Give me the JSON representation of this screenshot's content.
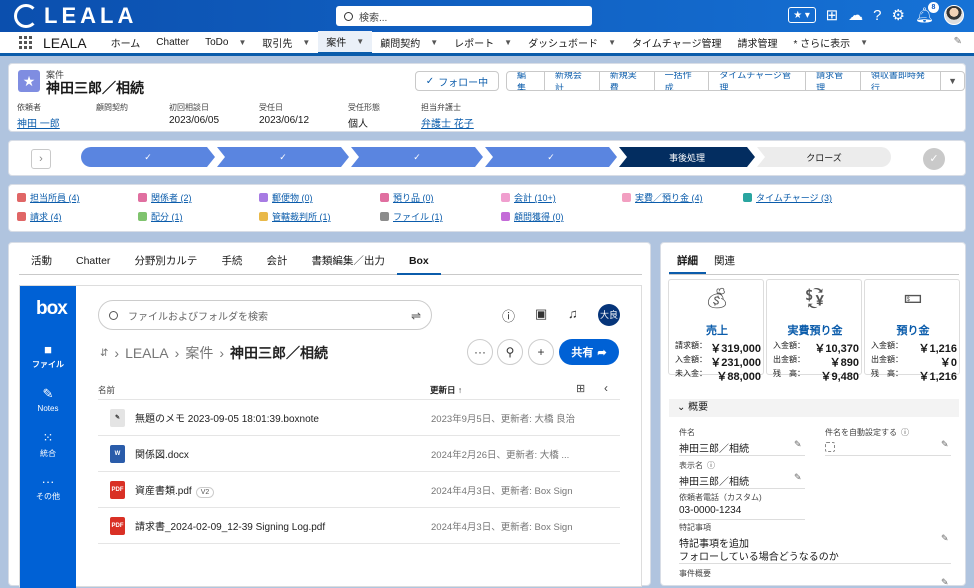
{
  "topbar": {
    "logo": "LEALA",
    "search_placeholder": "検索...",
    "notif_count": "8"
  },
  "nav": {
    "app": "LEALA",
    "items": [
      "ホーム",
      "Chatter",
      "ToDo",
      "取引先",
      "案件",
      "顧問契約",
      "レポート",
      "ダッシュボード",
      "タイムチャージ管理",
      "請求管理",
      "* さらに表示"
    ]
  },
  "record": {
    "type": "案件",
    "title": "神田三郎／相続",
    "follow": "フォロー中",
    "actions": [
      "編集",
      "新規会計",
      "新規実費",
      "一括作成",
      "タイムチャージ管理",
      "請求管理",
      "領収書即時発行",
      "▼"
    ],
    "fields": [
      {
        "label": "依頼者",
        "value": "神田 一郎",
        "link": true
      },
      {
        "label": "顧問契約",
        "value": "",
        "link": false
      },
      {
        "label": "初回相談日",
        "value": "2023/06/05",
        "link": false
      },
      {
        "label": "受任日",
        "value": "2023/06/12",
        "link": false
      },
      {
        "label": "受任形態",
        "value": "個人",
        "link": false
      },
      {
        "label": "担当弁護士",
        "value": "弁護士 花子",
        "link": true
      }
    ]
  },
  "path": {
    "stages": [
      "✓",
      "✓",
      "✓",
      "✓",
      "事後処理",
      "クローズ"
    ]
  },
  "related": [
    {
      "label": "担当所員 (4)",
      "color": "#e06666"
    },
    {
      "label": "関係者 (2)",
      "color": "#e06fa0"
    },
    {
      "label": "郵便物 (0)",
      "color": "#a77be3"
    },
    {
      "label": "預り品 (0)",
      "color": "#e06fa0"
    },
    {
      "label": "会計 (10+)",
      "color": "#f09fcf"
    },
    {
      "label": "実費／預り金 (4)",
      "color": "#f29fc1"
    },
    {
      "label": "タイムチャージ (3)",
      "color": "#2aa5a0"
    },
    {
      "label": "請求 (4)",
      "color": "#e06666"
    },
    {
      "label": "配分 (1)",
      "color": "#7fc36e"
    },
    {
      "label": "管轄裁判所 (1)",
      "color": "#e9b949"
    },
    {
      "label": "ファイル (1)",
      "color": "#8c8c8c"
    },
    {
      "label": "顧問獲得 (0)",
      "color": "#c46bd8"
    }
  ],
  "tabs": [
    "活動",
    "Chatter",
    "分野別カルテ",
    "手続",
    "会計",
    "書類編集／出力",
    "Box"
  ],
  "box": {
    "logo": "box",
    "side": [
      "ファイル",
      "Notes",
      "統合",
      "その他"
    ],
    "search_placeholder": "ファイルおよびフォルダを検索",
    "avatar": "大良",
    "crumbs": [
      "LEALA",
      "案件",
      "神田三郎／相続"
    ],
    "share": "共有",
    "col_name": "名前",
    "col_date": "更新日 ↑",
    "files": [
      {
        "name": "無題のメモ 2023-09-05 18:01:39.boxnote",
        "meta": "2023年9月5日、更新者: 大橋 良治",
        "type": "note",
        "badge": ""
      },
      {
        "name": "関係図.docx",
        "meta": "2024年2月26日、更新者: 大橋 ...",
        "type": "doc",
        "badge": ""
      },
      {
        "name": "資産書類.pdf",
        "meta": "2024年4月3日、更新者: Box Sign",
        "type": "pdf",
        "badge": "V2"
      },
      {
        "name": "請求書_2024-02-09_12-39 Signing Log.pdf",
        "meta": "2024年4月3日、更新者: Box Sign",
        "type": "pdf",
        "badge": ""
      }
    ]
  },
  "rtabs": [
    "詳細",
    "関連"
  ],
  "money": [
    {
      "title": "売上",
      "rows": [
        [
          "請求額：",
          "￥319,000"
        ],
        [
          "入金額：",
          "￥231,000"
        ],
        [
          "未入金：",
          "￥88,000"
        ]
      ]
    },
    {
      "title": "実費預り金",
      "rows": [
        [
          "入金額：",
          "￥10,370"
        ],
        [
          "出金額：",
          "￥890"
        ],
        [
          "残　高：",
          "￥9,480"
        ]
      ]
    },
    {
      "title": "預り金",
      "rows": [
        [
          "入金額：",
          "￥1,216"
        ],
        [
          "出金額：",
          "￥0"
        ],
        [
          "残　高：",
          "￥1,216"
        ]
      ]
    }
  ],
  "detail": {
    "section": "概要",
    "f1_label": "件名",
    "f1_value": "神田三郎／相続",
    "f2_label": "件名を自動設定する",
    "f3_label": "表示名",
    "f3_value": "神田三郎／相続",
    "f4_label": "依頼者電話（カスタム)",
    "f4_value": "03-0000-1234",
    "f5_label": "特記事項",
    "f5_value1": "特記事項を追加",
    "f5_value2": "フォローしている場合どうなるのか",
    "f6_label": "事件概要"
  }
}
